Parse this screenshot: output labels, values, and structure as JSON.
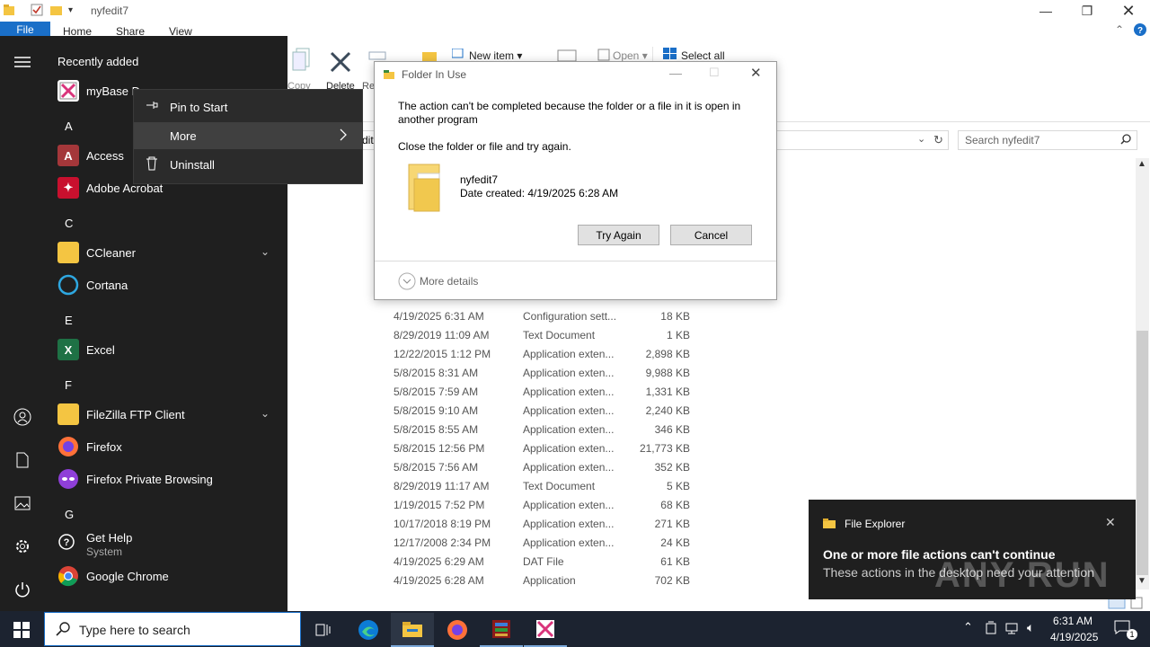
{
  "explorer": {
    "title": "nyfedit7",
    "tabs": [
      "File",
      "Home",
      "Share",
      "View"
    ],
    "ribbon": {
      "new_item": "New item",
      "open": "Open",
      "select_all": "Select all",
      "copy": "Copy",
      "delete": "Delete",
      "rename": "Re",
      "address_partial": "dit"
    },
    "search_placeholder": "Search nyfedit7",
    "files": [
      {
        "date": "4/19/2025 6:31 AM",
        "type": "Configuration sett...",
        "size": "18 KB"
      },
      {
        "date": "8/29/2019 11:09 AM",
        "type": "Text Document",
        "size": "1 KB"
      },
      {
        "date": "12/22/2015 1:12 PM",
        "type": "Application exten...",
        "size": "2,898 KB"
      },
      {
        "date": "5/8/2015 8:31 AM",
        "type": "Application exten...",
        "size": "9,988 KB"
      },
      {
        "date": "5/8/2015 7:59 AM",
        "type": "Application exten...",
        "size": "1,331 KB"
      },
      {
        "date": "5/8/2015 9:10 AM",
        "type": "Application exten...",
        "size": "2,240 KB"
      },
      {
        "date": "5/8/2015 8:55 AM",
        "type": "Application exten...",
        "size": "346 KB"
      },
      {
        "date": "5/8/2015 12:56 PM",
        "type": "Application exten...",
        "size": "21,773 KB"
      },
      {
        "date": "5/8/2015 7:56 AM",
        "type": "Application exten...",
        "size": "352 KB"
      },
      {
        "date": "8/29/2019 11:17 AM",
        "type": "Text Document",
        "size": "5 KB"
      },
      {
        "date": "1/19/2015 7:52 PM",
        "type": "Application exten...",
        "size": "68 KB"
      },
      {
        "date": "10/17/2018 8:19 PM",
        "type": "Application exten...",
        "size": "271 KB"
      },
      {
        "date": "12/17/2008 2:34 PM",
        "type": "Application exten...",
        "size": "24 KB"
      },
      {
        "date": "4/19/2025 6:29 AM",
        "type": "DAT File",
        "size": "61 KB"
      },
      {
        "date": "4/19/2025 6:28 AM",
        "type": "Application",
        "size": "702 KB"
      }
    ]
  },
  "start": {
    "recently_added": "Recently added",
    "apps": [
      {
        "label": "myBase D"
      },
      {
        "label": "Access"
      },
      {
        "label": "Adobe Acrobat"
      },
      {
        "label": "CCleaner"
      },
      {
        "label": "Cortana"
      },
      {
        "label": "Excel"
      },
      {
        "label": "FileZilla FTP Client"
      },
      {
        "label": "Firefox"
      },
      {
        "label": "Firefox Private Browsing"
      },
      {
        "label": "Get Help",
        "sub": "System"
      },
      {
        "label": "Google Chrome"
      }
    ],
    "letters": {
      "a": "A",
      "c": "C",
      "e": "E",
      "f": "F",
      "g": "G"
    }
  },
  "context_menu": {
    "pin": "Pin to Start",
    "more": "More",
    "uninstall": "Uninstall"
  },
  "dialog": {
    "title": "Folder In Use",
    "message": "The action can't be completed because the folder or a file in it is open in another program",
    "instruction": "Close the folder or file and try again.",
    "item_name": "nyfedit7",
    "item_date": "Date created: 4/19/2025 6:28 AM",
    "try_again": "Try Again",
    "cancel": "Cancel",
    "more_details": "More details"
  },
  "toast": {
    "app": "File Explorer",
    "heading": "One or more file actions can't continue",
    "body": "These actions in the desktop need your attention"
  },
  "taskbar": {
    "search_placeholder": "Type here to search",
    "time": "6:31 AM",
    "date": "4/19/2025"
  },
  "watermark": "ANY RUN"
}
